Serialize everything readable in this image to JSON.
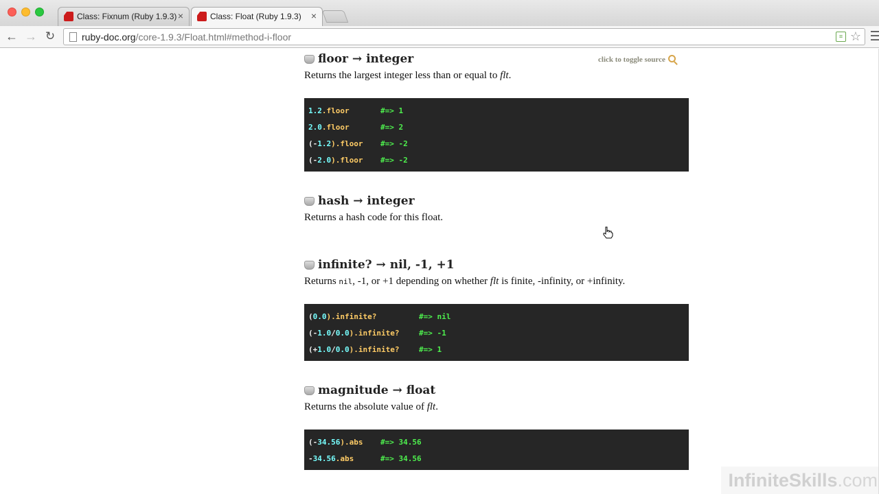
{
  "browser": {
    "tabs": [
      {
        "title": "Class: Fixnum (Ruby 1.9.3)",
        "close": "×"
      },
      {
        "title": "Class: Float (Ruby 1.9.3)",
        "close": "×"
      }
    ],
    "url_host": "ruby-doc.org",
    "url_path": "/core-1.9.3/Float.html#method-i-floor",
    "icons": {
      "back": "←",
      "forward": "→",
      "reload": "↻",
      "star": "☆",
      "ext": "≡"
    }
  },
  "doc": {
    "toggle_source": "click to toggle source",
    "methods": [
      {
        "signature": "floor → integer",
        "desc_parts": [
          "Returns the largest integer less than or equal to ",
          "flt",
          "."
        ],
        "code": [
          {
            "segs": [
              [
                "1.2",
                "num"
              ],
              [
                ".floor",
                "meth"
              ]
            ],
            "comment": "#=> 1"
          },
          {
            "segs": [
              [
                "2.0",
                "num"
              ],
              [
                ".floor",
                "meth"
              ]
            ],
            "comment": "#=> 2"
          },
          {
            "segs": [
              [
                "(-",
                "punct"
              ],
              [
                "1.2",
                "num"
              ],
              [
                ").floor",
                "meth"
              ]
            ],
            "comment": "#=> -2"
          },
          {
            "segs": [
              [
                "(-",
                "punct"
              ],
              [
                "2.0",
                "num"
              ],
              [
                ").floor",
                "meth"
              ]
            ],
            "comment": "#=> -2"
          }
        ]
      },
      {
        "signature": "hash → integer",
        "desc_parts": [
          "Returns a hash code for this float."
        ]
      },
      {
        "signature": "infinite? → nil, -1, +1",
        "desc_parts": [
          "Returns ",
          "nil",
          ", -1, or +1 depending on whether ",
          "flt",
          " is finite, -infinity, or +infinity."
        ],
        "code": [
          {
            "segs": [
              [
                "(",
                "punct"
              ],
              [
                "0.0",
                "num"
              ],
              [
                ").infinite?",
                "meth"
              ]
            ],
            "comment": "#=> nil"
          },
          {
            "segs": [
              [
                "(-",
                "punct"
              ],
              [
                "1.0",
                "num"
              ],
              [
                "/",
                "punct"
              ],
              [
                "0.0",
                "num"
              ],
              [
                ").infinite?",
                "meth"
              ]
            ],
            "comment": "#=> -1"
          },
          {
            "segs": [
              [
                "(+",
                "punct"
              ],
              [
                "1.0",
                "num"
              ],
              [
                "/",
                "punct"
              ],
              [
                "0.0",
                "num"
              ],
              [
                ").infinite?",
                "meth"
              ]
            ],
            "comment": "#=> 1"
          }
        ]
      },
      {
        "signature": "magnitude → float",
        "desc_parts": [
          "Returns the absolute value of ",
          "flt",
          "."
        ],
        "code": [
          {
            "segs": [
              [
                "(-",
                "punct"
              ],
              [
                "34.56",
                "num"
              ],
              [
                ").abs",
                "meth"
              ]
            ],
            "comment": "#=> 34.56"
          },
          {
            "segs": [
              [
                "-",
                "punct"
              ],
              [
                "34.56",
                "num"
              ],
              [
                ".abs",
                "meth"
              ]
            ],
            "comment": "#=> 34.56"
          }
        ]
      }
    ]
  },
  "watermark": {
    "brand": "InfiniteSkills",
    "tld": ".com"
  }
}
